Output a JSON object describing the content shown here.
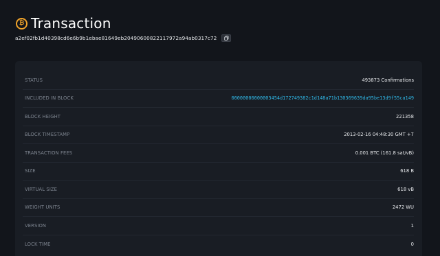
{
  "header": {
    "icon": "bitcoin-icon",
    "title": "Transaction",
    "txid": "a2ef02fb1d40398cd6e6b9b1ebae81649eb20490600822117972a94ab0317c72",
    "copy_icon": "copy-icon"
  },
  "details": {
    "rows": [
      {
        "label": "STATUS",
        "value": "493873 Confirmations"
      },
      {
        "label": "INCLUDED IN BLOCK",
        "value": "00000000000003454d172749382c1d148a71b130369639da95be13d9f55ca149"
      },
      {
        "label": "BLOCK HEIGHT",
        "value": "221358"
      },
      {
        "label": "BLOCK TIMESTAMP",
        "value": "2013-02-16 04:48:30 GMT +7"
      },
      {
        "label": "TRANSACTION FEES",
        "value": "0.001 BTC (161.8 sat/vB)"
      },
      {
        "label": "SIZE",
        "value": "618 B"
      },
      {
        "label": "VIRTUAL SIZE",
        "value": "618 vB"
      },
      {
        "label": "WEIGHT UNITS",
        "value": "2472 WU"
      },
      {
        "label": "VERSION",
        "value": "1"
      },
      {
        "label": "LOCK TIME",
        "value": "0"
      }
    ]
  },
  "colors": {
    "background": "#12151b",
    "card": "#191d24",
    "accent_link": "#2fb7e6",
    "bitcoin": "#f0a32a"
  }
}
